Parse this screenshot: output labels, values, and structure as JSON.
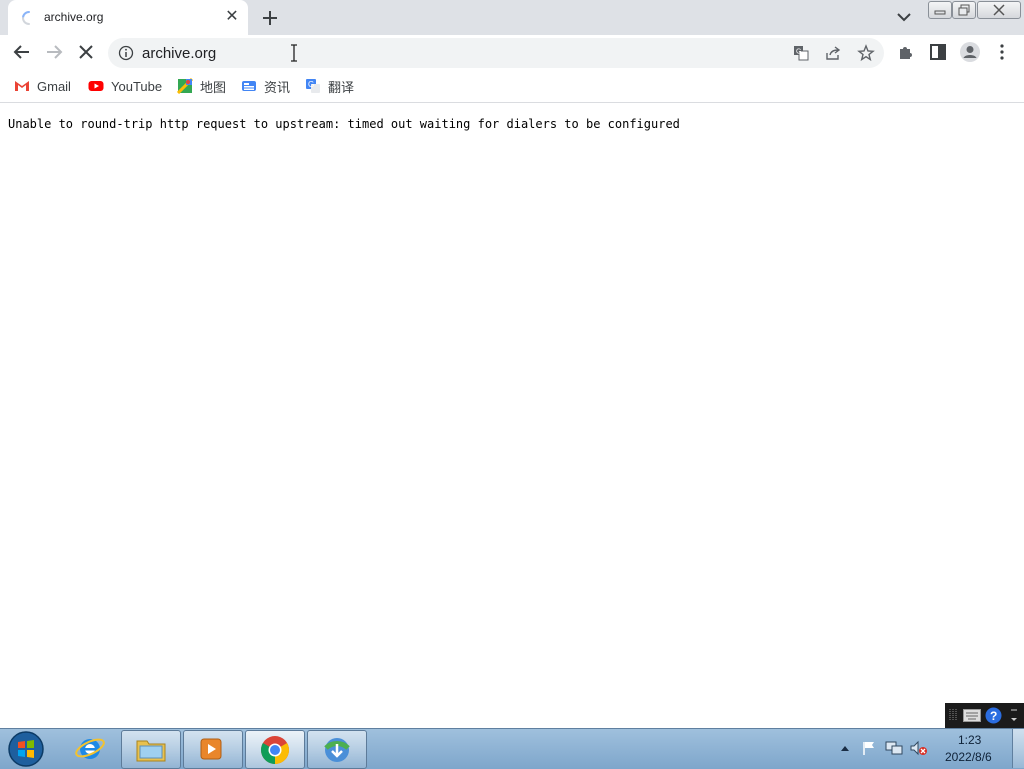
{
  "tab": {
    "title": "archive.org",
    "close_glyph": "✕"
  },
  "toolbar": {
    "url": "archive.org"
  },
  "bookmarks": [
    {
      "label": "Gmail",
      "icon": "gmail-icon"
    },
    {
      "label": "YouTube",
      "icon": "youtube-icon"
    },
    {
      "label": "地图",
      "icon": "maps-icon"
    },
    {
      "label": "资讯",
      "icon": "news-icon"
    },
    {
      "label": "翻译",
      "icon": "translate-icon"
    }
  ],
  "page": {
    "error_message": "Unable to round-trip http request to upstream: timed out waiting for dialers to be configured"
  },
  "clock": {
    "time": "1:23",
    "date": "2022/8/6"
  },
  "colors": {
    "tab_strip": "#dee1e6",
    "omnibox": "#f1f3f4",
    "taskbar": "#8fb4d6"
  }
}
